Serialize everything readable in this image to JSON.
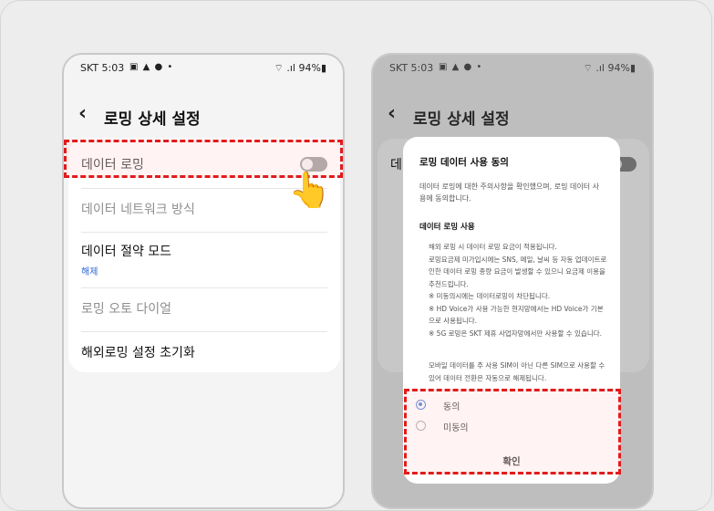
{
  "left_phone": {
    "status": {
      "carrier_time": "SKT 5:03",
      "icons": "▣ ▲ ● •",
      "battery": "⌔ .ıl 94%▮"
    },
    "header": {
      "back": "‹",
      "title": "로밍 상세 설정"
    },
    "items": [
      {
        "label": "데이터 로밍",
        "toggle": "off"
      },
      {
        "label": "데이터 네트워크 방식"
      },
      {
        "label": "데이터 절약 모드",
        "sub": "해제"
      },
      {
        "label": "로밍 오토 다이얼"
      },
      {
        "label": "해외로밍 설정 초기화"
      }
    ],
    "pointer": "👆"
  },
  "right_phone": {
    "status": {
      "carrier_time": "SKT 5:03",
      "icons": "▣ ▲ ● •",
      "battery": "⌔ .ıl 94%▮"
    },
    "header": {
      "back": "‹",
      "title": "로밍 상세 설정"
    },
    "bg_item_fragment": "데",
    "dialog": {
      "title": "로밍 데이터 사용 동의",
      "intro": "데이터 로밍에 대한 주의사항을 확인했으며, 로밍 데이터 사용에 동의합니다.",
      "section_title": "데이터 로밍 사용",
      "body_lines": [
        "해외 로밍 시 데이터 로밍 요금이 적용됩니다.",
        "로밍요금제 미가입시에는 SNS, 메일, 날씨 등 자동 업데이트로 인한 데이터 로밍 종량 요금이 발생할 수 있으니 요금제 이용을 추천드립니다.",
        "※ 미동의시에는 데이터로밍이 차단됩니다.",
        "※ HD Voice가 사용 가능한 현지망에서는 HD Voice가 기본으로 사용됩니다.",
        "※ 5G 로밍은 SKT 제휴 사업자망에서만 사용할 수 있습니다."
      ],
      "footnote": "모바일 데이터를 주 사용 SIM이 아닌 다른 SIM으로 사용할 수 있어 데이터 전환은 자동으로 해제됩니다.",
      "options": [
        {
          "label": "동의",
          "selected": true
        },
        {
          "label": "미동의",
          "selected": false
        }
      ],
      "confirm": "확인"
    }
  },
  "colors": {
    "highlight": "#e21b1b",
    "accent": "#2c66d2"
  }
}
